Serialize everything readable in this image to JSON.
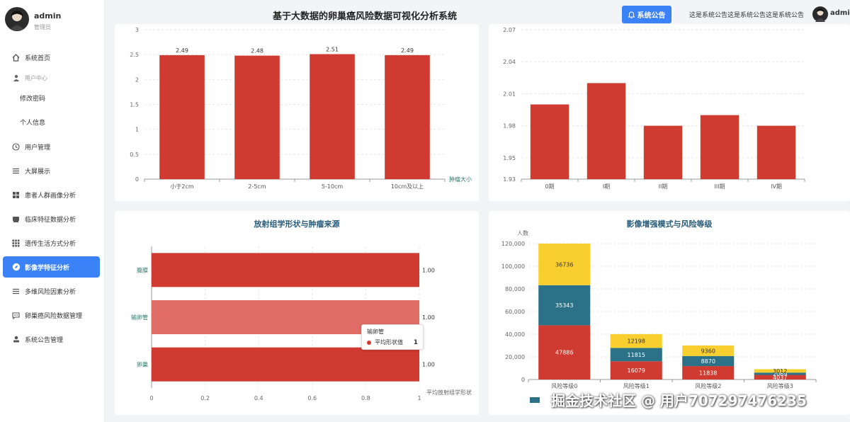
{
  "app": {
    "title": "基于大数据的卵巢癌风险数据可视化分析系统"
  },
  "user": {
    "name": "admin",
    "role": "管理员"
  },
  "header": {
    "notice_button": "系统公告",
    "notice_text": "这是系统公告这是系统公告这是系统公告",
    "user_name": "admin"
  },
  "sidebar": {
    "items": [
      {
        "label": "系统首页",
        "icon": "home-icon"
      },
      {
        "label": "用户中心",
        "icon": "user-icon"
      },
      {
        "label": "修改密码",
        "icon": ""
      },
      {
        "label": "个人信息",
        "icon": ""
      },
      {
        "label": "用户管理",
        "icon": "clock-icon"
      },
      {
        "label": "大屏展示",
        "icon": "list-icon"
      },
      {
        "label": "患者人群画像分析",
        "icon": "grid-icon"
      },
      {
        "label": "临床特征数据分析",
        "icon": "card-icon"
      },
      {
        "label": "遗传生活方式分析",
        "icon": "apps-icon"
      },
      {
        "label": "影像学特征分析",
        "icon": "compass-icon"
      },
      {
        "label": "多维风险因素分析",
        "icon": "list-icon"
      },
      {
        "label": "卵巢癌风险数据管理",
        "icon": "chat-icon"
      },
      {
        "label": "系统公告管理",
        "icon": "person-icon"
      }
    ]
  },
  "chart_data": [
    {
      "type": "bar",
      "categories": [
        "小于2cm",
        "2-5cm",
        "5-10cm",
        "10cm及以上"
      ],
      "values": [
        2.49,
        2.48,
        2.51,
        2.49
      ],
      "xlabel": "肿瘤大小",
      "ylim": [
        0,
        3
      ],
      "yticks": [
        0,
        0.5,
        1,
        1.5,
        2,
        2.5,
        3
      ],
      "color": "#d03b31"
    },
    {
      "type": "bar",
      "categories": [
        "0期",
        "I期",
        "II期",
        "III期",
        "IV期"
      ],
      "values": [
        2.0,
        2.02,
        1.98,
        1.99,
        1.98
      ],
      "ylim": [
        1.93,
        2.07
      ],
      "yticks": [
        1.93,
        1.95,
        1.98,
        2.01,
        2.04,
        2.07
      ],
      "color": "#d03b31"
    },
    {
      "type": "bar",
      "orientation": "horizontal",
      "title": "放射组学形状与肿瘤来源",
      "categories": [
        "卵巢",
        "输卵管",
        "腹膜"
      ],
      "values": [
        1.0,
        1.0,
        1.0
      ],
      "value_labels": [
        "1.00",
        "1.00",
        "1.00"
      ],
      "xlabel": "平均放射组学形状",
      "xlim": [
        0,
        1
      ],
      "xticks": [
        "0",
        "0.2",
        "0.4",
        "0.6",
        "0.8",
        "1"
      ],
      "color": "#d03b31",
      "highlight_color": "#e06c66",
      "tooltip": {
        "title": "输卵管",
        "series": "平均形状值",
        "value": "1"
      }
    },
    {
      "type": "bar",
      "stacked": true,
      "title": "影像增强模式与风险等级",
      "ylabel": "人数",
      "categories": [
        "风险等级0",
        "风险等级1",
        "风险等级2",
        "风险等级3"
      ],
      "series": [
        {
          "values": [
            47886,
            16079,
            11838,
            4037
          ],
          "color": "#d03b31"
        },
        {
          "values": [
            35343,
            11815,
            8870,
            2069
          ],
          "color": "#2b7188"
        },
        {
          "values": [
            36736,
            12198,
            9360,
            3012
          ],
          "color": "#f8cf2e"
        }
      ],
      "ylim": [
        0,
        120000
      ],
      "yticks": [
        "0",
        "20,000",
        "40,000",
        "60,000",
        "80,000",
        "100,000",
        "120,000"
      ]
    }
  ],
  "watermark": "掘金技术社区 @ 用户707297476235"
}
